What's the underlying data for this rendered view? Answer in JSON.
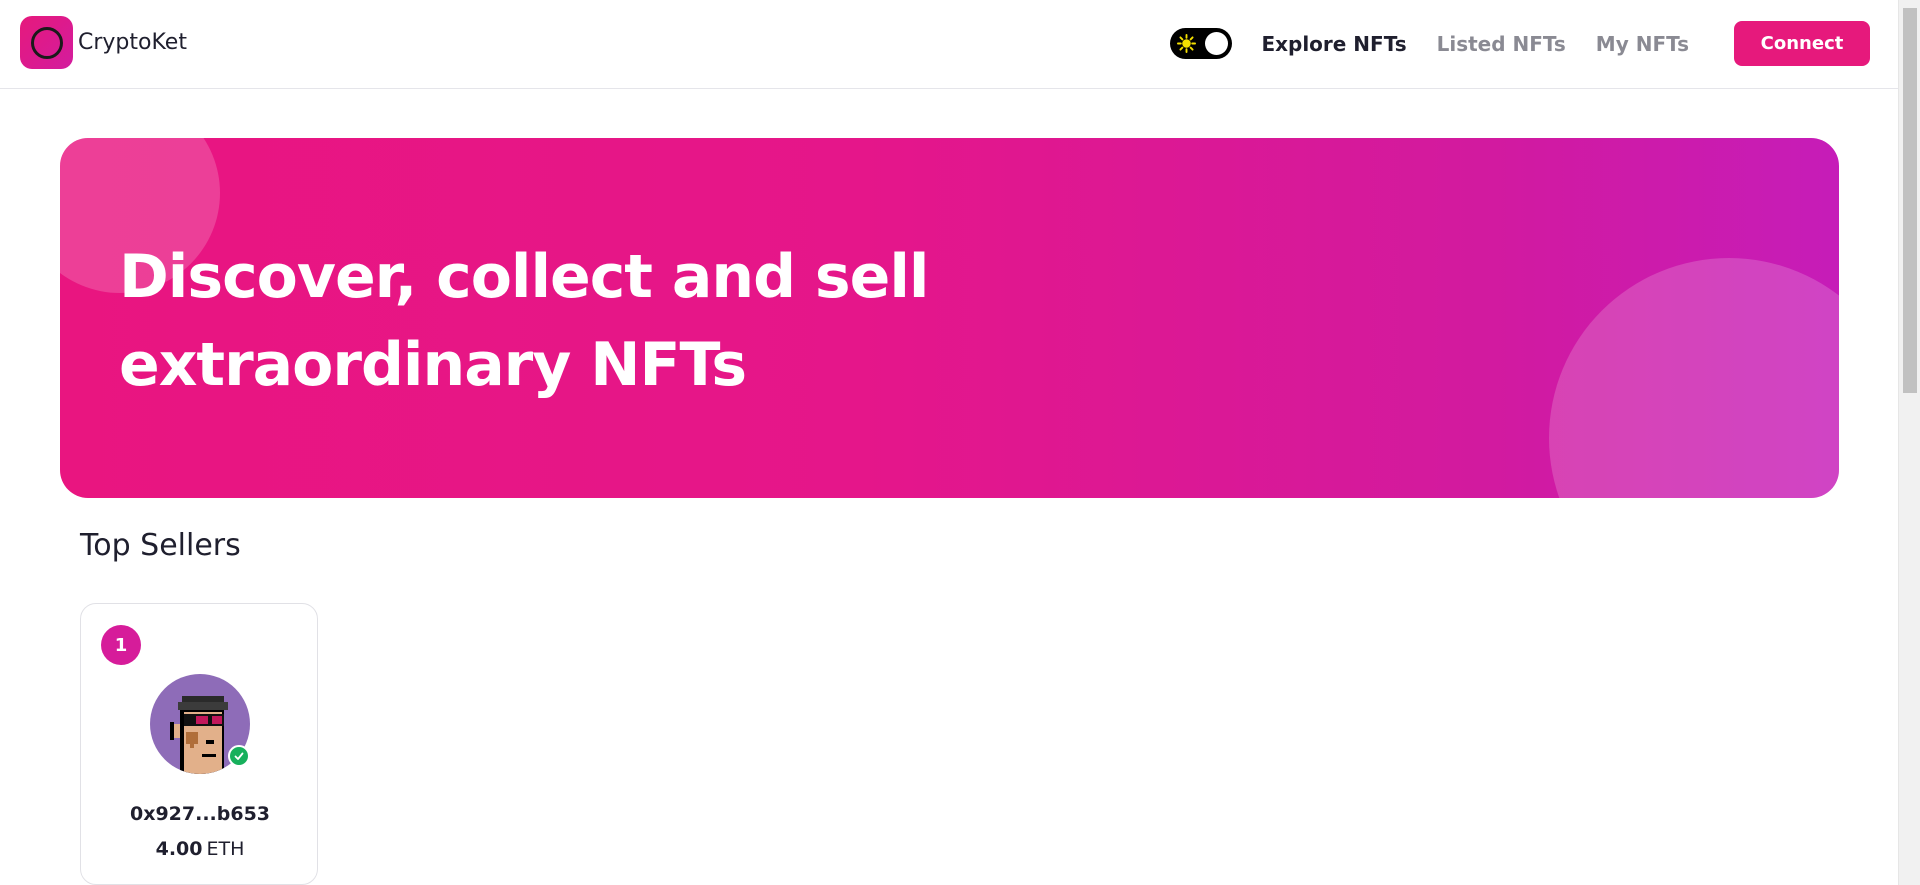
{
  "brand": {
    "name": "CryptoKet"
  },
  "nav": {
    "links": [
      {
        "label": "Explore NFTs",
        "active": true
      },
      {
        "label": "Listed NFTs",
        "active": false
      },
      {
        "label": "My NFTs",
        "active": false
      }
    ],
    "connect_label": "Connect",
    "theme_icon": "sun-icon"
  },
  "hero": {
    "title": "Discover, collect and sell extraordinary NFTs"
  },
  "top_sellers": {
    "title": "Top Sellers",
    "items": [
      {
        "rank": "1",
        "address": "0x927...b653",
        "amount": "4.00",
        "currency": "ETH",
        "verified": true
      }
    ]
  },
  "colors": {
    "accent": "#e6197c",
    "accent_purple": "#c61cb8",
    "verified": "#17b05c",
    "avatar_bg": "#8e6cb8"
  }
}
